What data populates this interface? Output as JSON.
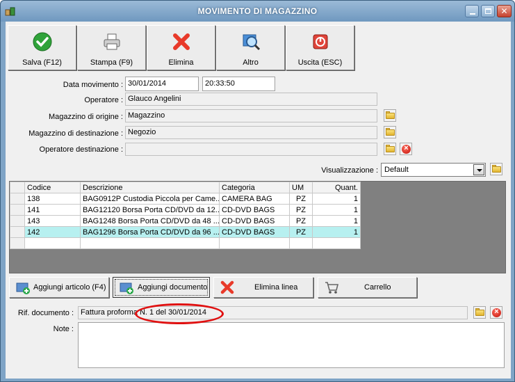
{
  "window": {
    "title": "MOVIMENTO DI MAGAZZINO"
  },
  "toolbar": [
    {
      "label": "Salva (F12)",
      "icon": "check-icon"
    },
    {
      "label": "Stampa (F9)",
      "icon": "printer-icon"
    },
    {
      "label": "Elimina",
      "icon": "delete-x-icon"
    },
    {
      "label": "Altro",
      "icon": "magnifier-icon"
    },
    {
      "label": "Uscita (ESC)",
      "icon": "exit-icon"
    }
  ],
  "form": {
    "data_movimento_label": "Data movimento :",
    "data_movimento_date": "30/01/2014",
    "data_movimento_time": "20:33:50",
    "operatore_label": "Operatore :",
    "operatore_value": "Glauco Angelini",
    "magazzino_origine_label": "Magazzino di origine :",
    "magazzino_origine_value": "Magazzino",
    "magazzino_destinazione_label": "Magazzino di destinazione :",
    "magazzino_destinazione_value": "Negozio",
    "operatore_destinazione_label": "Operatore destinazione :",
    "operatore_destinazione_value": "",
    "visualizzazione_label": "Visualizzazione :",
    "visualizzazione_value": "Default"
  },
  "grid": {
    "columns": [
      "Codice",
      "Descrizione",
      "Categoria",
      "UM",
      "Quant."
    ],
    "rows": [
      {
        "codice": "138",
        "descrizione": "BAG0912P Custodia Piccola per Came...",
        "categoria": "CAMERA BAG",
        "um": "PZ",
        "quant": "1"
      },
      {
        "codice": "141",
        "descrizione": "BAG12120 Borsa Porta CD/DVD da 12...",
        "categoria": "CD-DVD BAGS",
        "um": "PZ",
        "quant": "1"
      },
      {
        "codice": "143",
        "descrizione": "BAG1248 Borsa Porta CD/DVD da 48 ...",
        "categoria": "CD-DVD BAGS",
        "um": "PZ",
        "quant": "1"
      },
      {
        "codice": "142",
        "descrizione": "BAG1296 Borsa Porta CD/DVD da 96 ...",
        "categoria": "CD-DVD BAGS",
        "um": "PZ",
        "quant": "1"
      }
    ]
  },
  "actions": {
    "aggiungi_articolo": "Aggiungi articolo (F4)",
    "aggiungi_documento": "Aggiungi documento",
    "elimina_linea": "Elimina linea",
    "carrello": "Carrello"
  },
  "rif_documento": {
    "label": "Rif. documento :",
    "value": "Fattura proforma N. 1 del 30/01/2014"
  },
  "note": {
    "label": "Note :",
    "value": ""
  },
  "colors": {
    "titlebar": "#7fa4c6",
    "selected_row": "#b7f0f0",
    "annotation": "#e01010"
  }
}
